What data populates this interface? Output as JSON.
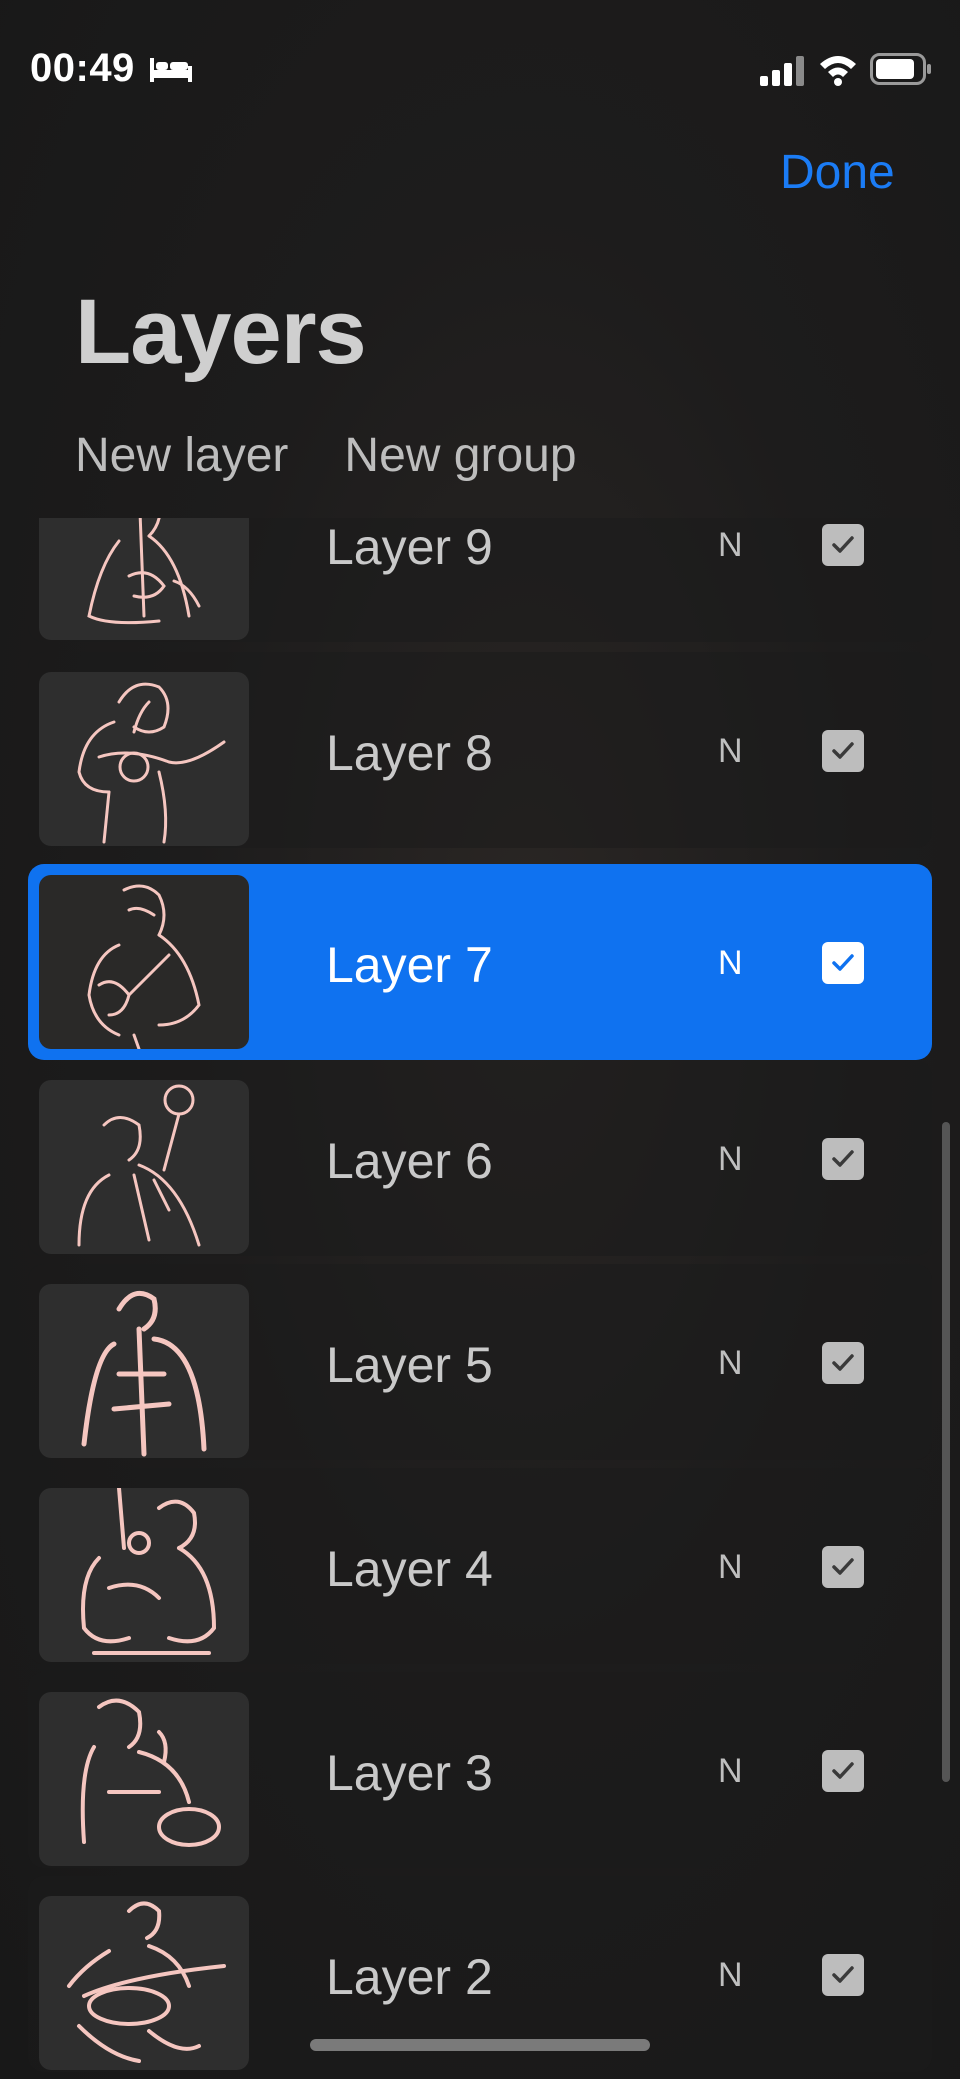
{
  "status_bar": {
    "time": "00:49",
    "icons": [
      "sleep-icon",
      "signal-icon",
      "wifi-icon",
      "battery-icon"
    ]
  },
  "header": {
    "done_label": "Done",
    "title": "Layers",
    "actions": [
      "New layer",
      "New group"
    ]
  },
  "layers": [
    {
      "name": "Layer 9",
      "blend": "N",
      "visible": true,
      "selected": false
    },
    {
      "name": "Layer 8",
      "blend": "N",
      "visible": true,
      "selected": false
    },
    {
      "name": "Layer 7",
      "blend": "N",
      "visible": true,
      "selected": true
    },
    {
      "name": "Layer 6",
      "blend": "N",
      "visible": true,
      "selected": false
    },
    {
      "name": "Layer 5",
      "blend": "N",
      "visible": true,
      "selected": false
    },
    {
      "name": "Layer 4",
      "blend": "N",
      "visible": true,
      "selected": false
    },
    {
      "name": "Layer 3",
      "blend": "N",
      "visible": true,
      "selected": false
    },
    {
      "name": "Layer 2",
      "blend": "N",
      "visible": true,
      "selected": false
    }
  ],
  "colors": {
    "accent": "#1b7cf5",
    "selected_row": "#0f72f0",
    "sketch_stroke": "#f5c6c0"
  }
}
